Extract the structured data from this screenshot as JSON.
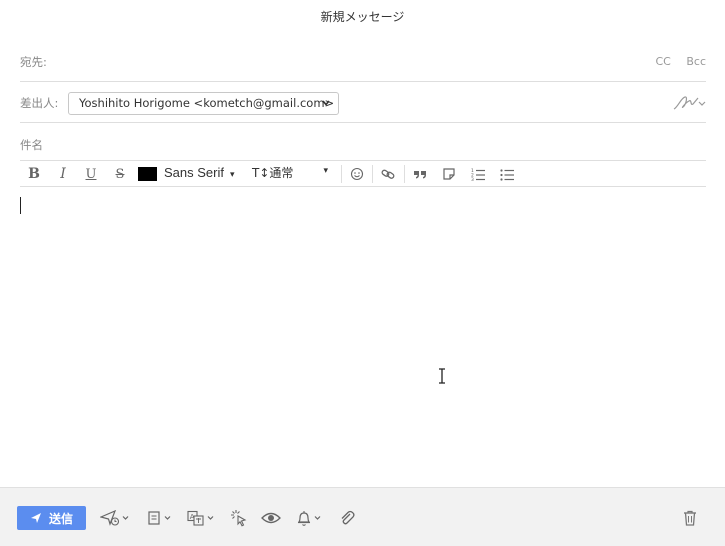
{
  "window": {
    "title": "新規メッセージ"
  },
  "to": {
    "label": "宛先:",
    "cc_label": "CC",
    "bcc_label": "Bcc"
  },
  "from": {
    "label": "差出人:",
    "value": "Yoshihito Horigome <kometch@gmail.com>"
  },
  "subject": {
    "label": "件名"
  },
  "toolbar": {
    "bold": "B",
    "italic": "I",
    "underline": "U",
    "strike": "S",
    "text_color": "#000000",
    "font": "Sans Serif",
    "font_arrow": "▾",
    "size_prefix": "T↕",
    "size": "通常",
    "size_arrow": "▾",
    "icons": [
      "emoji-icon",
      "link-icon",
      "quote-icon",
      "note-icon",
      "numbered-list-icon",
      "bulleted-list-icon"
    ]
  },
  "footer": {
    "send_label": "送信",
    "accent": "#5b8def",
    "icons": [
      "scheduled-send-icon",
      "template-icon",
      "translate-icon",
      "click-tracking-icon",
      "read-tracking-icon",
      "reminder-bell-icon",
      "attachment-icon",
      "trash-icon"
    ]
  }
}
